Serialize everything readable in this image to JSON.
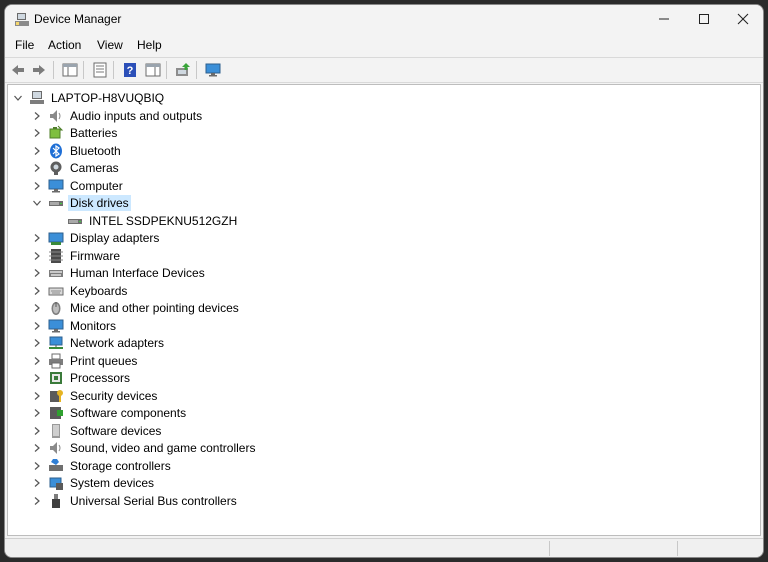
{
  "window": {
    "title": "Device Manager"
  },
  "menu": [
    {
      "id": "file",
      "label": "File"
    },
    {
      "id": "action",
      "label": "Action"
    },
    {
      "id": "view",
      "label": "View"
    },
    {
      "id": "help",
      "label": "Help"
    }
  ],
  "toolbar": [
    {
      "name": "back-button",
      "icon": "back-arrow-icon"
    },
    {
      "name": "forward-button",
      "icon": "forward-arrow-icon"
    },
    {
      "name": "show-hide-console-tree-button",
      "icon": "console-tree-icon"
    },
    {
      "name": "properties-button",
      "icon": "properties-icon"
    },
    {
      "name": "help-button",
      "icon": "help-icon"
    },
    {
      "name": "show-action-pane-button",
      "icon": "action-pane-icon"
    },
    {
      "name": "scan-hardware-changes-button",
      "icon": "update-driver-icon"
    },
    {
      "name": "monitor-button",
      "icon": "monitor-icon"
    }
  ],
  "tree": {
    "root": {
      "label": "LAPTOP-H8VUQBIQ",
      "icon": "computer-icon",
      "expanded": true
    },
    "items": [
      {
        "label": "Audio inputs and outputs",
        "icon": "speaker-icon",
        "expanded": false
      },
      {
        "label": "Batteries",
        "icon": "battery-icon",
        "expanded": false
      },
      {
        "label": "Bluetooth",
        "icon": "bluetooth-icon",
        "expanded": false
      },
      {
        "label": "Cameras",
        "icon": "camera-icon",
        "expanded": false
      },
      {
        "label": "Computer",
        "icon": "monitor-icon",
        "expanded": false
      },
      {
        "label": "Disk drives",
        "icon": "disk-drive-icon",
        "expanded": true,
        "selected": true,
        "children": [
          {
            "label": "INTEL SSDPEKNU512GZH",
            "icon": "disk-drive-icon"
          }
        ]
      },
      {
        "label": "Display adapters",
        "icon": "display-adapter-icon",
        "expanded": false
      },
      {
        "label": "Firmware",
        "icon": "firmware-icon",
        "expanded": false
      },
      {
        "label": "Human Interface Devices",
        "icon": "hid-icon",
        "expanded": false
      },
      {
        "label": "Keyboards",
        "icon": "keyboard-icon",
        "expanded": false
      },
      {
        "label": "Mice and other pointing devices",
        "icon": "mouse-icon",
        "expanded": false
      },
      {
        "label": "Monitors",
        "icon": "monitor-icon",
        "expanded": false
      },
      {
        "label": "Network adapters",
        "icon": "network-adapter-icon",
        "expanded": false
      },
      {
        "label": "Print queues",
        "icon": "printer-icon",
        "expanded": false
      },
      {
        "label": "Processors",
        "icon": "processor-icon",
        "expanded": false
      },
      {
        "label": "Security devices",
        "icon": "security-device-icon",
        "expanded": false
      },
      {
        "label": "Software components",
        "icon": "software-component-icon",
        "expanded": false
      },
      {
        "label": "Software devices",
        "icon": "software-device-icon",
        "expanded": false
      },
      {
        "label": "Sound, video and game controllers",
        "icon": "sound-icon",
        "expanded": false
      },
      {
        "label": "Storage controllers",
        "icon": "storage-controller-icon",
        "expanded": false
      },
      {
        "label": "System devices",
        "icon": "system-devices-icon",
        "expanded": false
      },
      {
        "label": "Universal Serial Bus controllers",
        "icon": "usb-icon",
        "expanded": false
      }
    ]
  },
  "colors": {
    "selection": "#cce8ff",
    "accent": "#2b6fd6"
  }
}
